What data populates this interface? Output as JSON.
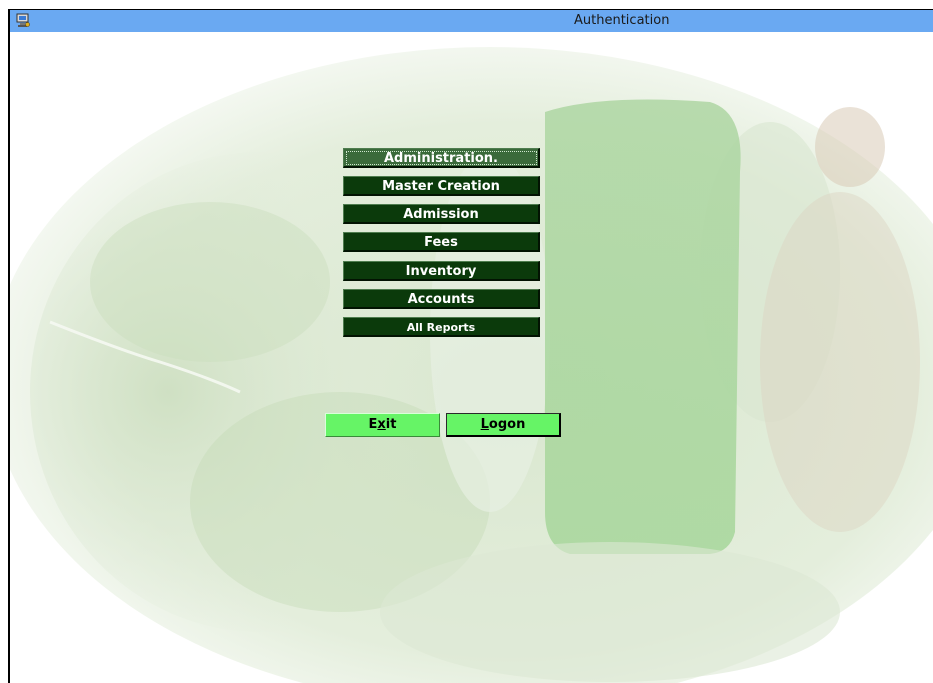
{
  "window": {
    "title": "Authentication",
    "icon": "app-computer-icon"
  },
  "menu": {
    "items": [
      {
        "label": "Administration.",
        "selected": true
      },
      {
        "label": "Master Creation"
      },
      {
        "label": "Admission"
      },
      {
        "label": "Fees"
      },
      {
        "label": "Inventory"
      },
      {
        "label": "Accounts"
      },
      {
        "label": "All Reports"
      }
    ]
  },
  "actions": {
    "exit": {
      "prefix": "E",
      "accel": "x",
      "suffix": "it"
    },
    "logon": {
      "prefix": "",
      "accel": "L",
      "suffix": "ogon"
    }
  },
  "colors": {
    "titlebar": "#6aa9f2",
    "menu_button": "#0b3a0b",
    "action_button": "#66f466"
  }
}
